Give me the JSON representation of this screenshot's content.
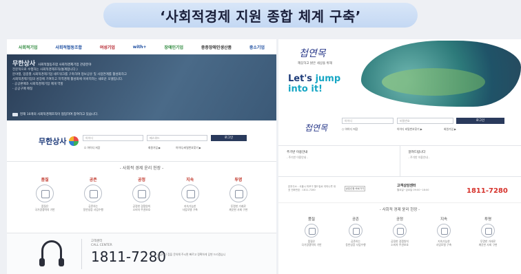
{
  "slide_title": "‘사회적경제 지원 종합 체계 구축’",
  "left": {
    "logos": [
      "사회적기업",
      "사회적협동조합",
      "여성기업",
      "with+",
      "장애인기업",
      "중증장애인생산품",
      "중소기업"
    ],
    "hero": {
      "brand": "무한상사",
      "brand_tag": "사회적협동조합 사회적경제기업 관광분야",
      "lines": [
        "전문적으로 수행하는 사회적경제조직(통계합니다.)",
        "분야별, 업종별 사회적경제기업 네트워크를 구축하여 정보공유 및 사업연계를 활성화하고",
        "사회적경제기업의 성장에 기여하고 지역경제 활성화에 이바지하는 새로운 모델입니다.",
        "- 공공판매과 사회적경제기업 매개 역할",
        "- 공공구매 매칭"
      ],
      "notice": "현재 10개의 사회적경제조직이 협업하여 참여하고 있습니다."
    },
    "login": {
      "logo": "무한상사",
      "id_placeholder": "아이디",
      "pw_placeholder": "패스워드",
      "login_button": "로그인",
      "save_id": "아이디 저장",
      "join": "회원가입 ▶",
      "find": "아이디/비밀번호찾기 ▶"
    },
    "values_title": "- 사회적 경제 윤리 헌장 -",
    "values": [
      {
        "name": "품질",
        "desc": "품질은\n국가경쟁력의 기반"
      },
      {
        "name": "공존",
        "desc": "공존하는\n동반성장 사업수행"
      },
      {
        "name": "공정",
        "desc": "공정한 경쟁원칙\n소비자 주권보호"
      },
      {
        "name": "지속",
        "desc": "지속가능한\n사업모델 구축"
      },
      {
        "name": "투명",
        "desc": "투명한 거래로\n깨끗한 사회 구현"
      }
    ],
    "callcenter": {
      "label_ko": "고객센터",
      "label_en": "CALL CENTER",
      "phone": "1811-7280",
      "note": "궁금하신 점을 문의해 주시면 빠르고 정확하게 답변 드리겠습니다."
    }
  },
  "right": {
    "hero": {
      "brand": "첩연목",
      "tagline": "깨끗하고 밝은 세상을 위해",
      "jump_1": "Let's ",
      "jump_accent": "jump",
      "jump_2": "into it!"
    },
    "login": {
      "brand": "첩연목",
      "id_placeholder": "아이디",
      "pw_placeholder": "비밀번호",
      "login_button": "로그인",
      "save_id": "아이디 저장",
      "find": "아이디 비밀번호찾기 ▶",
      "join": "회원가입 ▶"
    },
    "boards": [
      {
        "title": "주기반 이용안내",
        "sub": "- 주기반 이용안내 -"
      },
      {
        "title": "알려드립니다",
        "sub": "- 주기반 이용안내 -"
      }
    ],
    "cc": {
      "addr": "본부주소 : 서울시 마포구 월드컵로 여의나루 대표 전화번호 : 1811-7280",
      "mini_button": "상담신청 바로가기",
      "title": "고객상담센터",
      "sub": "월요일~금요일 09:00~18:00",
      "phone": "1811-7280"
    },
    "values_title": "- 사회적 경제 윤리 헌장 -",
    "values": [
      {
        "name": "품질",
        "desc": "품질은\n국가경쟁력의 기반"
      },
      {
        "name": "공존",
        "desc": "공존하는\n동반성장 사업수행"
      },
      {
        "name": "공정",
        "desc": "공정한 경쟁원칙\n소비자 주권보호"
      },
      {
        "name": "지속",
        "desc": "지속가능한\n사업모델 구축"
      },
      {
        "name": "투명",
        "desc": "투명한 거래로\n깨끗한 사회 구현"
      }
    ]
  }
}
